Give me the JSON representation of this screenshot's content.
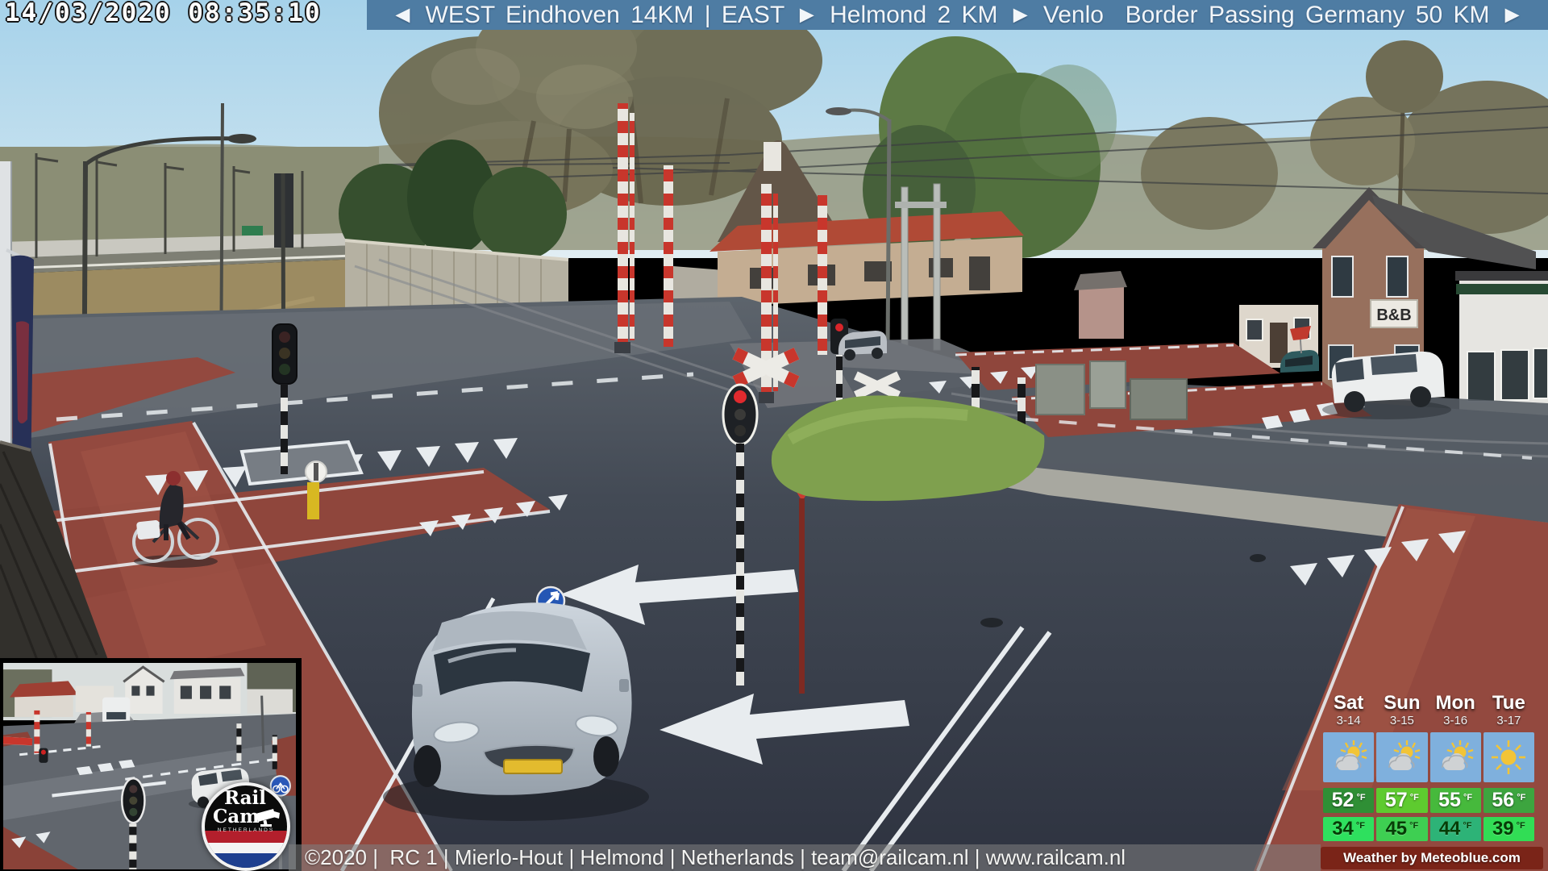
{
  "header": {
    "timestamp": "14/03/2020 08:35:10",
    "banner": "◄ WEST Eindhoven 14KM | EAST ► Helmond 2 KM ► Venlo  Border Passing Germany 50 KM ►"
  },
  "footer": {
    "credit": "©2020 |  RC 1 | Mierlo-Hout | Helmond | Netherlands | team@railcam.nl | www.railcam.nl",
    "weather_attribution": "Weather by Meteoblue.com"
  },
  "weather": {
    "unit": "°F",
    "days": [
      {
        "label": "Sat",
        "date": "3-14",
        "icon": "partly-cloudy",
        "high": "52",
        "low": "34",
        "high_bg": "#2f8f35",
        "low_bg": "#2ee05e"
      },
      {
        "label": "Sun",
        "date": "3-15",
        "icon": "partly-cloudy",
        "high": "57",
        "low": "45",
        "high_bg": "#5ecb2f",
        "low_bg": "#3ecf52"
      },
      {
        "label": "Mon",
        "date": "3-16",
        "icon": "partly-cloudy",
        "high": "55",
        "low": "44",
        "high_bg": "#46b93c",
        "low_bg": "#2db377"
      },
      {
        "label": "Tue",
        "date": "3-17",
        "icon": "sunny",
        "high": "56",
        "low": "39",
        "high_bg": "#3da53f",
        "low_bg": "#31dd55"
      }
    ]
  },
  "logo": {
    "line1": "Rail",
    "line2": "Cam",
    "country": "NETHERLANDS"
  },
  "scene": {
    "bnb_sign": "B&B"
  },
  "colors": {
    "banner_bg": "#4e7ca3",
    "meteoblue_bg": "#7a2418",
    "logo_flag_red": "#b31f2c",
    "logo_flag_blue": "#1e3f8f",
    "cycle_lane_red": "#93493f",
    "barrier_red": "#c8362c"
  }
}
